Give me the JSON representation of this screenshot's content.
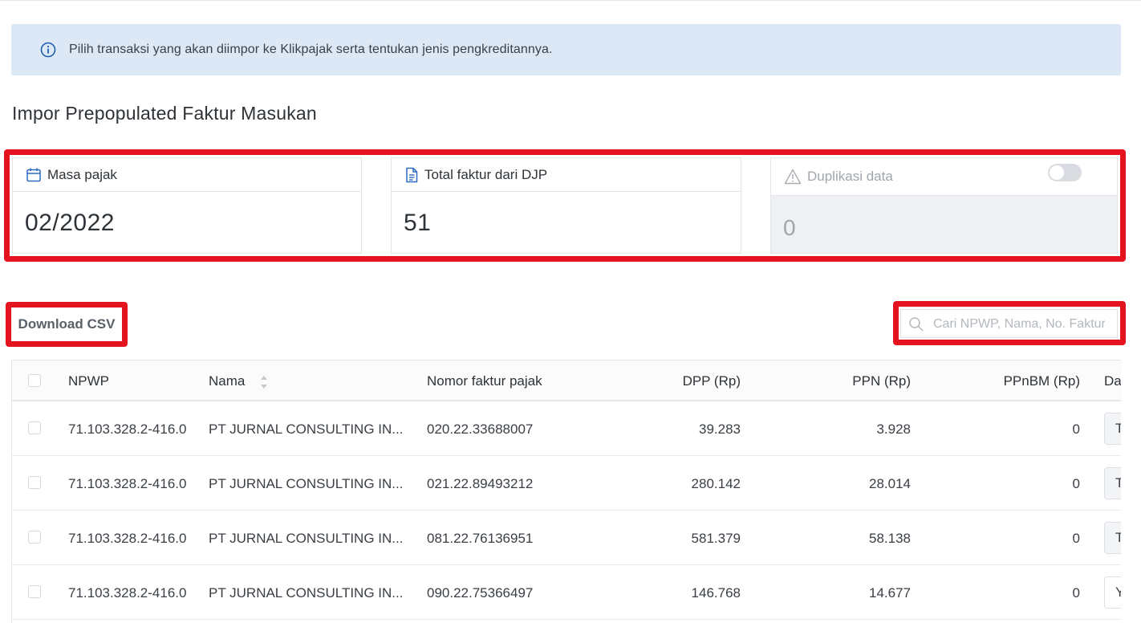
{
  "banner": {
    "icon": "info-circle-icon",
    "text": "Pilih transaksi yang akan diimpor ke Klikpajak serta tentukan jenis pengkreditannya."
  },
  "page_title": "Impor Prepopulated Faktur Masukan",
  "cards": {
    "masa_pajak": {
      "icon": "calendar-icon",
      "label": "Masa pajak",
      "value": "02/2022"
    },
    "total_faktur": {
      "icon": "document-icon",
      "label": "Total faktur dari DJP",
      "value": "51"
    },
    "duplikasi": {
      "icon": "warning-icon",
      "label": "Duplikasi data",
      "value": "0",
      "toggle_on": false
    }
  },
  "toolbar": {
    "download_csv_label": "Download CSV",
    "search_placeholder": "Cari NPWP, Nama, No. Faktur"
  },
  "table": {
    "columns": {
      "npwp": "NPWP",
      "nama": "Nama",
      "nomor": "Nomor faktur pajak",
      "dpp": "DPP (Rp)",
      "ppn": "PPN (Rp)",
      "ppnbm": "PPnBM (Rp)",
      "last": "Da"
    },
    "rows": [
      {
        "npwp": "71.103.328.2-416.0",
        "nama": "PT JURNAL CONSULTING IN...",
        "nomor": "020.22.33688007",
        "dpp": "39.283",
        "ppn": "3.928",
        "ppnbm": "0",
        "action": "T"
      },
      {
        "npwp": "71.103.328.2-416.0",
        "nama": "PT JURNAL CONSULTING IN...",
        "nomor": "021.22.89493212",
        "dpp": "280.142",
        "ppn": "28.014",
        "ppnbm": "0",
        "action": "T"
      },
      {
        "npwp": "71.103.328.2-416.0",
        "nama": "PT JURNAL CONSULTING IN...",
        "nomor": "081.22.76136951",
        "dpp": "581.379",
        "ppn": "58.138",
        "ppnbm": "0",
        "action": "T"
      },
      {
        "npwp": "71.103.328.2-416.0",
        "nama": "PT JURNAL CONSULTING IN...",
        "nomor": "090.22.75366497",
        "dpp": "146.768",
        "ppn": "14.677",
        "ppnbm": "0",
        "action": "Y"
      }
    ]
  },
  "colors": {
    "banner_bg": "#dce8f6",
    "highlight_red": "#e3141f",
    "text_dark": "#2e3338",
    "muted": "#a0a6ad"
  }
}
